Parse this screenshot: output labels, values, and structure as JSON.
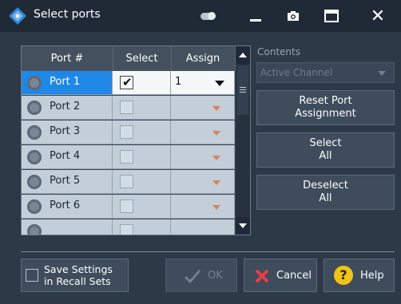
{
  "window": {
    "title": "Select ports",
    "buttons": {
      "toggle": "toggle-icon",
      "minimize": "minimize-icon",
      "screenshot": "camera-icon",
      "maximize": "maximize-icon",
      "close": "✕"
    }
  },
  "table": {
    "columns": [
      "Port #",
      "Select",
      "Assign"
    ],
    "rows": [
      {
        "port": "Port 1",
        "selected": true,
        "assign": "1"
      },
      {
        "port": "Port 2",
        "selected": false,
        "assign": ""
      },
      {
        "port": "Port 3",
        "selected": false,
        "assign": ""
      },
      {
        "port": "Port 4",
        "selected": false,
        "assign": ""
      },
      {
        "port": "Port 5",
        "selected": false,
        "assign": ""
      },
      {
        "port": "Port 6",
        "selected": false,
        "assign": ""
      }
    ]
  },
  "contents": {
    "label": "Contents",
    "value": "Active Channel"
  },
  "side_buttons": {
    "reset": "Reset Port\nAssignment",
    "select_all": "Select\nAll",
    "deselect_all": "Deselect\nAll"
  },
  "footer": {
    "save_settings": "Save Settings\nin Recall Sets",
    "ok": "OK",
    "cancel": "Cancel",
    "help": "Help"
  },
  "colors": {
    "background": "#2d3947",
    "titlebar": "#1f2a36",
    "selection": "#1f88e6",
    "help_yellow": "#f2c316",
    "cancel_red": "#e5404a"
  }
}
